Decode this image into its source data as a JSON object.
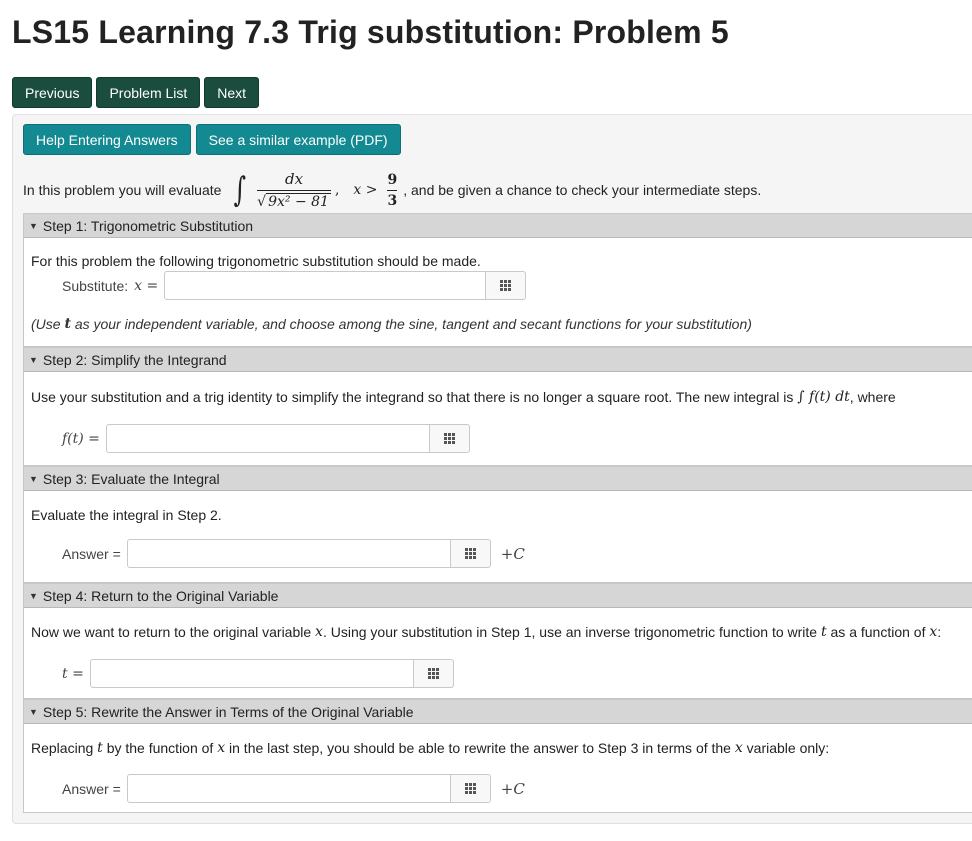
{
  "page": {
    "title": "LS15 Learning 7.3 Trig substitution: Problem 5"
  },
  "nav": {
    "previous": "Previous",
    "problem_list": "Problem List",
    "next": "Next"
  },
  "help": {
    "help_entering": "Help Entering Answers",
    "similar_example": "See a similar example (PDF)"
  },
  "intro": {
    "prefix": "In this problem you will evaluate",
    "numerator": "dx",
    "radicand": "9x² − 81",
    "condition": "x >",
    "cond_num": "9",
    "cond_den": "3",
    "suffix": ", and be given a chance to check your intermediate steps."
  },
  "steps": [
    {
      "header": "Step 1: Trigonometric Substitution",
      "text": "For this problem the following trigonometric substitution should be made.",
      "field_label": "Substitute:",
      "field_var": "x =",
      "note_pre": "(Use",
      "note_var": "t",
      "note_post": "as your independent variable, and choose among the sine, tangent and secant functions for your substitution)"
    },
    {
      "header": "Step 2: Simplify the Integrand",
      "text": "Use your substitution and a trig identity to simplify the integrand so that there is no longer a square root. The new integral is",
      "integral_expr": "∫ f(t) dt",
      "text_end": ", where",
      "field_var": "f(t) ="
    },
    {
      "header": "Step 3: Evaluate the Integral",
      "text": "Evaluate the integral in Step 2.",
      "field_label": "Answer =",
      "suffix": "+C"
    },
    {
      "header": "Step 4: Return to the Original Variable",
      "text_a": "Now we want to return to the original variable",
      "var_x": "x",
      "text_b": ". Using your substitution in Step 1, use an inverse trigonometric function to write",
      "var_t": "t",
      "text_c": "as a function of",
      "text_d": ":",
      "field_var": "t ="
    },
    {
      "header": "Step 5: Rewrite the Answer in Terms of the Original Variable",
      "text_a": "Replacing",
      "var_t": "t",
      "text_b": "by the function of",
      "var_x": "x",
      "text_c": "in the last step, you should be able to rewrite the answer to Step 3 in terms of the",
      "text_d": "variable only:",
      "field_label": "Answer =",
      "suffix": "+C"
    }
  ],
  "icons": {
    "palette": "grid-icon",
    "caret": "caret-down-icon"
  }
}
